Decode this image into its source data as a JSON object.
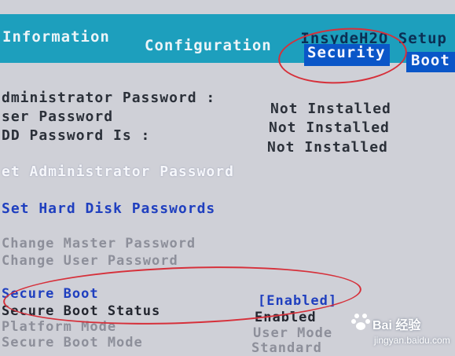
{
  "header": {
    "vendor_title": "InsydeH2O Setup",
    "tabs": [
      {
        "label": "Information",
        "selected": false
      },
      {
        "label": "Configuration",
        "selected": false
      },
      {
        "label": "Security",
        "selected": true
      },
      {
        "label": "Boot",
        "selected": false
      }
    ]
  },
  "status": {
    "admin_password_label": "dministrator Password :",
    "admin_password_value": "Not Installed",
    "user_password_label": "ser Password",
    "user_password_value": "Not Installed",
    "hdd_password_label": "DD Password Is :",
    "hdd_password_value": "Not Installed"
  },
  "actions": {
    "set_admin_password": "et Administrator Password",
    "set_hdd_passwords": "Set Hard Disk Passwords",
    "change_master_password": "Change Master Password",
    "change_user_password": "Change User Password"
  },
  "secure_boot": {
    "label": "Secure Boot",
    "value": "[Enabled]",
    "status_label": "Secure Boot Status",
    "status_value": "Enabled",
    "platform_mode_label": "Platform Mode",
    "platform_mode_value": "User Mode",
    "boot_mode_label": "Secure Boot Mode",
    "boot_mode_value": "Standard"
  },
  "watermark": {
    "brand": "Bai 经验",
    "url": "jingyan.baidu.com"
  },
  "colors": {
    "header_bg": "#1d9fbd",
    "selected_tab_bg": "#0a56c8",
    "screen_bg": "#cfd0d7",
    "annotation": "#d6303a"
  }
}
